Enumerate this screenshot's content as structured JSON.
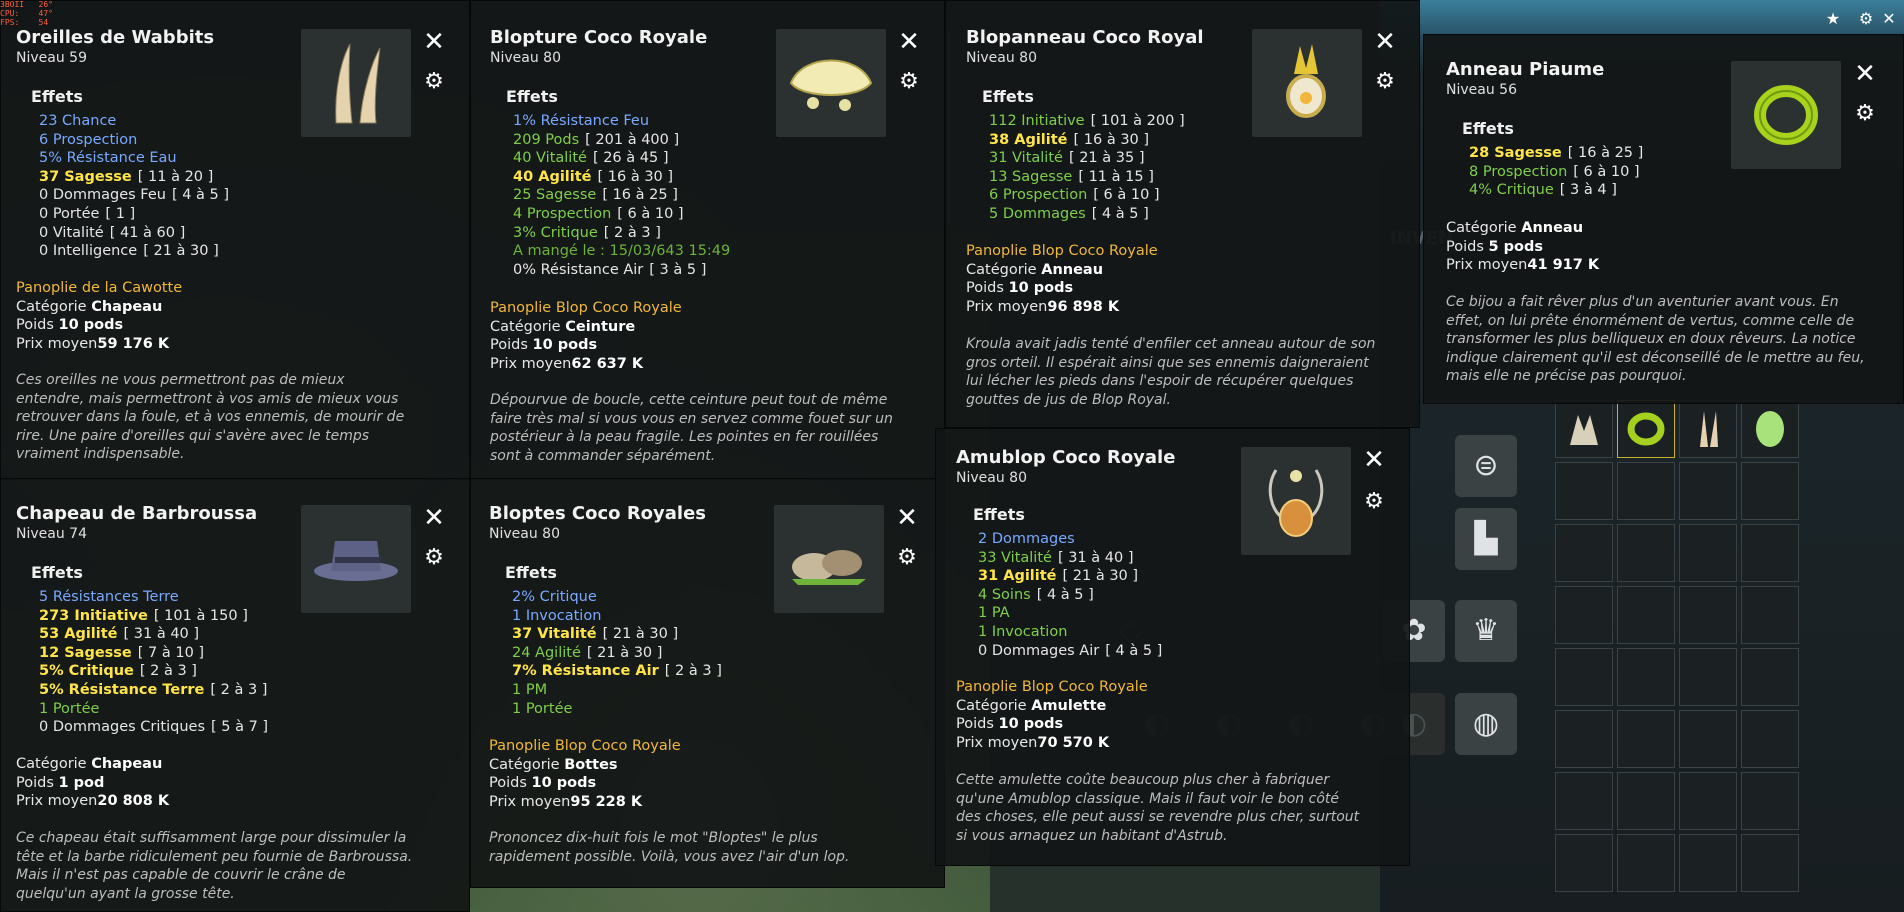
{
  "fps_overlay": "3BOII   26°\nCPU:    47°\nFPS:    54",
  "background": {
    "inventory_label": "INVEN"
  },
  "cards": [
    {
      "name": "Oreilles de Wabbits",
      "level": "Niveau 59",
      "icon": "bunny-ears-icon",
      "effects_title": "Effets",
      "effects": [
        {
          "value": "23 Chance",
          "color": "blue",
          "range": ""
        },
        {
          "value": "6 Prospection",
          "color": "blue",
          "range": ""
        },
        {
          "value": "5% Résistance Eau",
          "color": "blue",
          "range": ""
        },
        {
          "value": "37 Sagesse",
          "color": "yellow",
          "range": "[ 11 à 20 ]"
        },
        {
          "value": "0 Dommages Feu",
          "color": "white",
          "range": "[ 4 à 5 ]"
        },
        {
          "value": "0 Portée",
          "color": "white",
          "range": "[ 1 ]"
        },
        {
          "value": "0 Vitalité",
          "color": "white",
          "range": "[ 41 à 60 ]"
        },
        {
          "value": "0 Intelligence",
          "color": "white",
          "range": "[ 21 à 30 ]"
        }
      ],
      "panoplie": "Panoplie de la Cawotte",
      "category_label": "Catégorie",
      "category": "Chapeau",
      "weight_label": "Poids",
      "weight": "10 pods",
      "price_label": "Prix moyen",
      "price": "59 176 K",
      "description": "Ces oreilles ne vous permettront pas de mieux entendre, mais permettront à vos amis de mieux vous retrouver dans la foule, et à vos ennemis, de mourir de rire. Une paire d'oreilles qui s'avère avec le temps vraiment indispensable."
    },
    {
      "name": "Blopture Coco Royale",
      "level": "Niveau 80",
      "icon": "belt-icon",
      "effects_title": "Effets",
      "effects": [
        {
          "value": "1% Résistance Feu",
          "color": "blue",
          "range": ""
        },
        {
          "value": "209 Pods",
          "color": "green",
          "range": "[ 201 à 400 ]"
        },
        {
          "value": "40 Vitalité",
          "color": "green",
          "range": "[ 26 à 45 ]"
        },
        {
          "value": "40 Agilité",
          "color": "yellow",
          "range": "[ 16 à 30 ]"
        },
        {
          "value": "25 Sagesse",
          "color": "green",
          "range": "[ 16 à 25 ]"
        },
        {
          "value": "4 Prospection",
          "color": "green",
          "range": "[ 6 à 10 ]"
        },
        {
          "value": "3% Critique",
          "color": "green",
          "range": "[ 2 à 3 ]"
        },
        {
          "value": "A mangé le : 15/03/643 15:49",
          "color": "darkgreen",
          "range": ""
        },
        {
          "value": "0% Résistance Air",
          "color": "white",
          "range": "[ 3 à 5 ]"
        }
      ],
      "panoplie": "Panoplie Blop Coco Royale",
      "category_label": "Catégorie",
      "category": "Ceinture",
      "weight_label": "Poids",
      "weight": "10 pods",
      "price_label": "Prix moyen",
      "price": "62 637 K",
      "description": "Dépourvue de boucle, cette ceinture peut tout de même faire très mal si vous vous en servez comme fouet sur un postérieur à la peau fragile. Les pointes en fer rouillées sont à commander séparément."
    },
    {
      "name": "Blopanneau Coco Royal",
      "level": "Niveau 80",
      "icon": "ring-icon",
      "effects_title": "Effets",
      "effects": [
        {
          "value": "112 Initiative",
          "color": "green",
          "range": "[ 101 à 200 ]"
        },
        {
          "value": "38 Agilité",
          "color": "yellow",
          "range": "[ 16 à 30 ]"
        },
        {
          "value": "31 Vitalité",
          "color": "green",
          "range": "[ 21 à 35 ]"
        },
        {
          "value": "13 Sagesse",
          "color": "green",
          "range": "[ 11 à 15 ]"
        },
        {
          "value": "6 Prospection",
          "color": "green",
          "range": "[ 6 à 10 ]"
        },
        {
          "value": "5 Dommages",
          "color": "green",
          "range": "[ 4 à 5 ]"
        }
      ],
      "panoplie": "Panoplie Blop Coco Royale",
      "category_label": "Catégorie",
      "category": "Anneau",
      "weight_label": "Poids",
      "weight": "10 pods",
      "price_label": "Prix moyen",
      "price": "96 898 K",
      "description": "Kroula avait jadis tenté d'enfiler cet anneau autour de son gros orteil. Il espérait ainsi que ses ennemis daigneraient lui lécher les pieds dans l'espoir de récupérer quelques gouttes de jus de Blop Royal."
    },
    {
      "name": "Anneau Piaume",
      "level": "Niveau 56",
      "icon": "green-ring-icon",
      "effects_title": "Effets",
      "effects": [
        {
          "value": "28 Sagesse",
          "color": "yellow",
          "range": "[ 16 à 25 ]"
        },
        {
          "value": "8 Prospection",
          "color": "green",
          "range": "[ 6 à 10 ]"
        },
        {
          "value": "4% Critique",
          "color": "green",
          "range": "[ 3 à 4 ]"
        }
      ],
      "panoplie": "",
      "category_label": "Catégorie",
      "category": "Anneau",
      "weight_label": "Poids",
      "weight": "5 pods",
      "price_label": "Prix moyen",
      "price": "41 917 K",
      "description": "Ce bijou a fait rêver plus d'un aventurier avant vous. En effet, on lui prête énormément de vertus, comme celle de transformer les plus belliqueux en doux rêveurs. La notice indique clairement qu'il est déconseillé de le mettre au feu, mais elle ne précise pas pourquoi."
    },
    {
      "name": "Chapeau de Barbroussa",
      "level": "Niveau 74",
      "icon": "hat-icon",
      "effects_title": "Effets",
      "effects": [
        {
          "value": "5 Résistances Terre",
          "color": "blue",
          "range": ""
        },
        {
          "value": "273 Initiative",
          "color": "yellow",
          "range": "[ 101 à 150 ]"
        },
        {
          "value": "53 Agilité",
          "color": "yellow",
          "range": "[ 31 à 40 ]"
        },
        {
          "value": "12 Sagesse",
          "color": "yellow",
          "range": "[ 7 à 10 ]"
        },
        {
          "value": "5% Critique",
          "color": "yellow",
          "range": "[ 2 à 3 ]"
        },
        {
          "value": "5% Résistance Terre",
          "color": "yellow",
          "range": "[ 2 à 3 ]"
        },
        {
          "value": "1 Portée",
          "color": "green",
          "range": ""
        },
        {
          "value": "0 Dommages Critiques",
          "color": "white",
          "range": "[ 5 à 7 ]"
        }
      ],
      "panoplie": "",
      "category_label": "Catégorie",
      "category": "Chapeau",
      "weight_label": "Poids",
      "weight": "1 pod",
      "price_label": "Prix moyen",
      "price": "20 808 K",
      "description": "Ce chapeau était suffisamment large pour dissimuler la tête et la barbe ridiculement peu fournie de Barbroussa. Mais il n'est pas capable de couvrir le crâne de quelqu'un ayant la grosse tête."
    },
    {
      "name": "Bloptes Coco Royales",
      "level": "Niveau 80",
      "icon": "boots-icon",
      "effects_title": "Effets",
      "effects": [
        {
          "value": "2% Critique",
          "color": "blue",
          "range": ""
        },
        {
          "value": "1 Invocation",
          "color": "blue",
          "range": ""
        },
        {
          "value": "37 Vitalité",
          "color": "yellow",
          "range": "[ 21 à 30 ]"
        },
        {
          "value": "24 Agilité",
          "color": "green",
          "range": "[ 21 à 30 ]"
        },
        {
          "value": "7% Résistance Air",
          "color": "yellow",
          "range": "[ 2 à 3 ]"
        },
        {
          "value": "1 PM",
          "color": "green",
          "range": ""
        },
        {
          "value": "1 Portée",
          "color": "green",
          "range": ""
        }
      ],
      "panoplie": "Panoplie Blop Coco Royale",
      "category_label": "Catégorie",
      "category": "Bottes",
      "weight_label": "Poids",
      "weight": "10 pods",
      "price_label": "Prix moyen",
      "price": "95 228 K",
      "description": "Prononcez dix-huit fois le mot \"Bloptes\" le plus rapidement possible. Voilà, vous avez l'air d'un lop."
    },
    {
      "name": "Amublop Coco Royale",
      "level": "Niveau 80",
      "icon": "amulet-icon",
      "effects_title": "Effets",
      "effects": [
        {
          "value": "2 Dommages",
          "color": "blue",
          "range": ""
        },
        {
          "value": "33 Vitalité",
          "color": "green",
          "range": "[ 31 à 40 ]"
        },
        {
          "value": "31 Agilité",
          "color": "yellow",
          "range": "[ 21 à 30 ]"
        },
        {
          "value": "4 Soins",
          "color": "green",
          "range": "[ 4 à 5 ]"
        },
        {
          "value": "1 PA",
          "color": "green",
          "range": ""
        },
        {
          "value": "1 Invocation",
          "color": "green",
          "range": ""
        },
        {
          "value": "0 Dommages Air",
          "color": "white",
          "range": "[ 4 à 5 ]"
        }
      ],
      "panoplie": "Panoplie Blop Coco Royale",
      "category_label": "Catégorie",
      "category": "Amulette",
      "weight_label": "Poids",
      "weight": "10 pods",
      "price_label": "Prix moyen",
      "price": "70 570 K",
      "description": "Cette amulette coûte beaucoup plus cher à fabriquer qu'une Amublop classique. Mais il faut voir le bon côté des choses, elle peut aussi se revendre plus cher, surtout si vous arnaquez un habitant d'Astrub."
    }
  ],
  "colors": {
    "blue": "#79a9ff",
    "green": "#7fcf4a",
    "yellow": "#ffe54a",
    "white": "#e6e6e6",
    "darkgreen": "#6bb33a",
    "panoplie": "#f0b73c"
  }
}
